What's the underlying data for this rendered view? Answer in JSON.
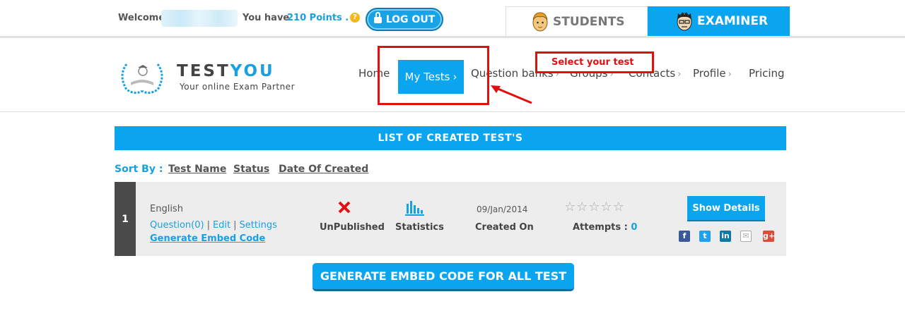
{
  "topbar": {
    "welcome": "Welcome",
    "you_have": "You have",
    "points": "210 Points .",
    "help": "?",
    "logout_label": "LOG OUT"
  },
  "role_tabs": {
    "students": "STUDENTS",
    "examiner": "EXAMINER"
  },
  "logo": {
    "test": "TEST",
    "you": "YOU",
    "tagline": "Your online Exam Partner"
  },
  "nav": {
    "home": "Home",
    "my_tests": "My Tests",
    "question_banks": "Question banks",
    "groups": "Groups",
    "contacts": "Contacts",
    "profile": "Profile",
    "pricing": "Pricing"
  },
  "callout": {
    "text": "Select your test",
    "color": "#e01010"
  },
  "list": {
    "title": "LIST OF CREATED TEST'S",
    "sort_by": "Sort By :",
    "sort_options": [
      "Test Name",
      "Status",
      "Date Of Created"
    ]
  },
  "tests": [
    {
      "number": "1",
      "name": "English",
      "question_link": "Question(0)",
      "edit_link": "Edit",
      "settings_link": "Settings",
      "embed_link": "Generate Embed Code",
      "status_icon": "x-mark-icon",
      "status": "UnPublished",
      "stats_icon": "bar-chart-icon",
      "stats_label": "Statistics",
      "date": "09/Jan/2014",
      "date_label": "Created On",
      "rating": 0,
      "rating_max": 5,
      "attempts_label": "Attempts :",
      "attempts_value": "0",
      "show_details": "Show Details",
      "share_icons": [
        "facebook-icon",
        "twitter-icon",
        "linkedin-icon",
        "email-icon",
        "google-plus-icon"
      ]
    }
  ],
  "generate_all_label": "GENERATE EMBED CODE FOR ALL TEST",
  "colors": {
    "accent": "#0aa4ef",
    "highlight": "#e01010"
  }
}
